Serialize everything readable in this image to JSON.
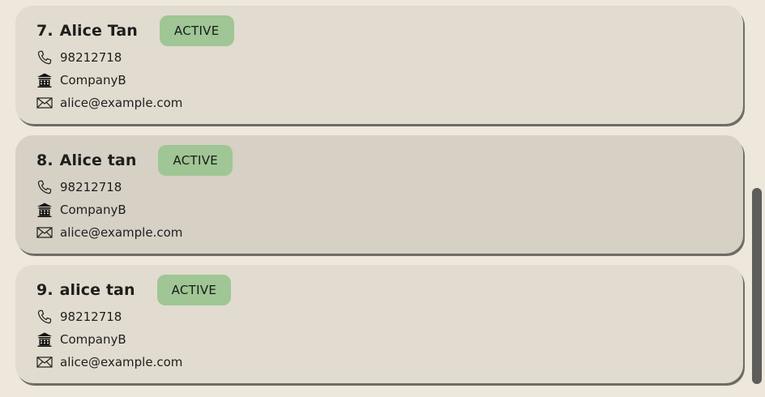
{
  "persons": [
    {
      "index": "7.",
      "name": "Alice Tan",
      "tag": "ACTIVE",
      "phone": "98212718",
      "company": "CompanyB",
      "email": "alice@example.com",
      "selected": false
    },
    {
      "index": "8.",
      "name": "Alice tan",
      "tag": "ACTIVE",
      "phone": "98212718",
      "company": "CompanyB",
      "email": "alice@example.com",
      "selected": true
    },
    {
      "index": "9.",
      "name": "alice tan",
      "tag": "ACTIVE",
      "phone": "98212718",
      "company": "CompanyB",
      "email": "alice@example.com",
      "selected": false
    }
  ],
  "icons": {
    "phone": "phone-icon",
    "company": "building-icon",
    "email": "envelope-icon"
  },
  "colors": {
    "background": "#ede7dc",
    "card": "#e1dccf",
    "card_selected": "#d6d0c5",
    "tag": "#9fc694",
    "scrollbar": "#5d5d5a"
  }
}
